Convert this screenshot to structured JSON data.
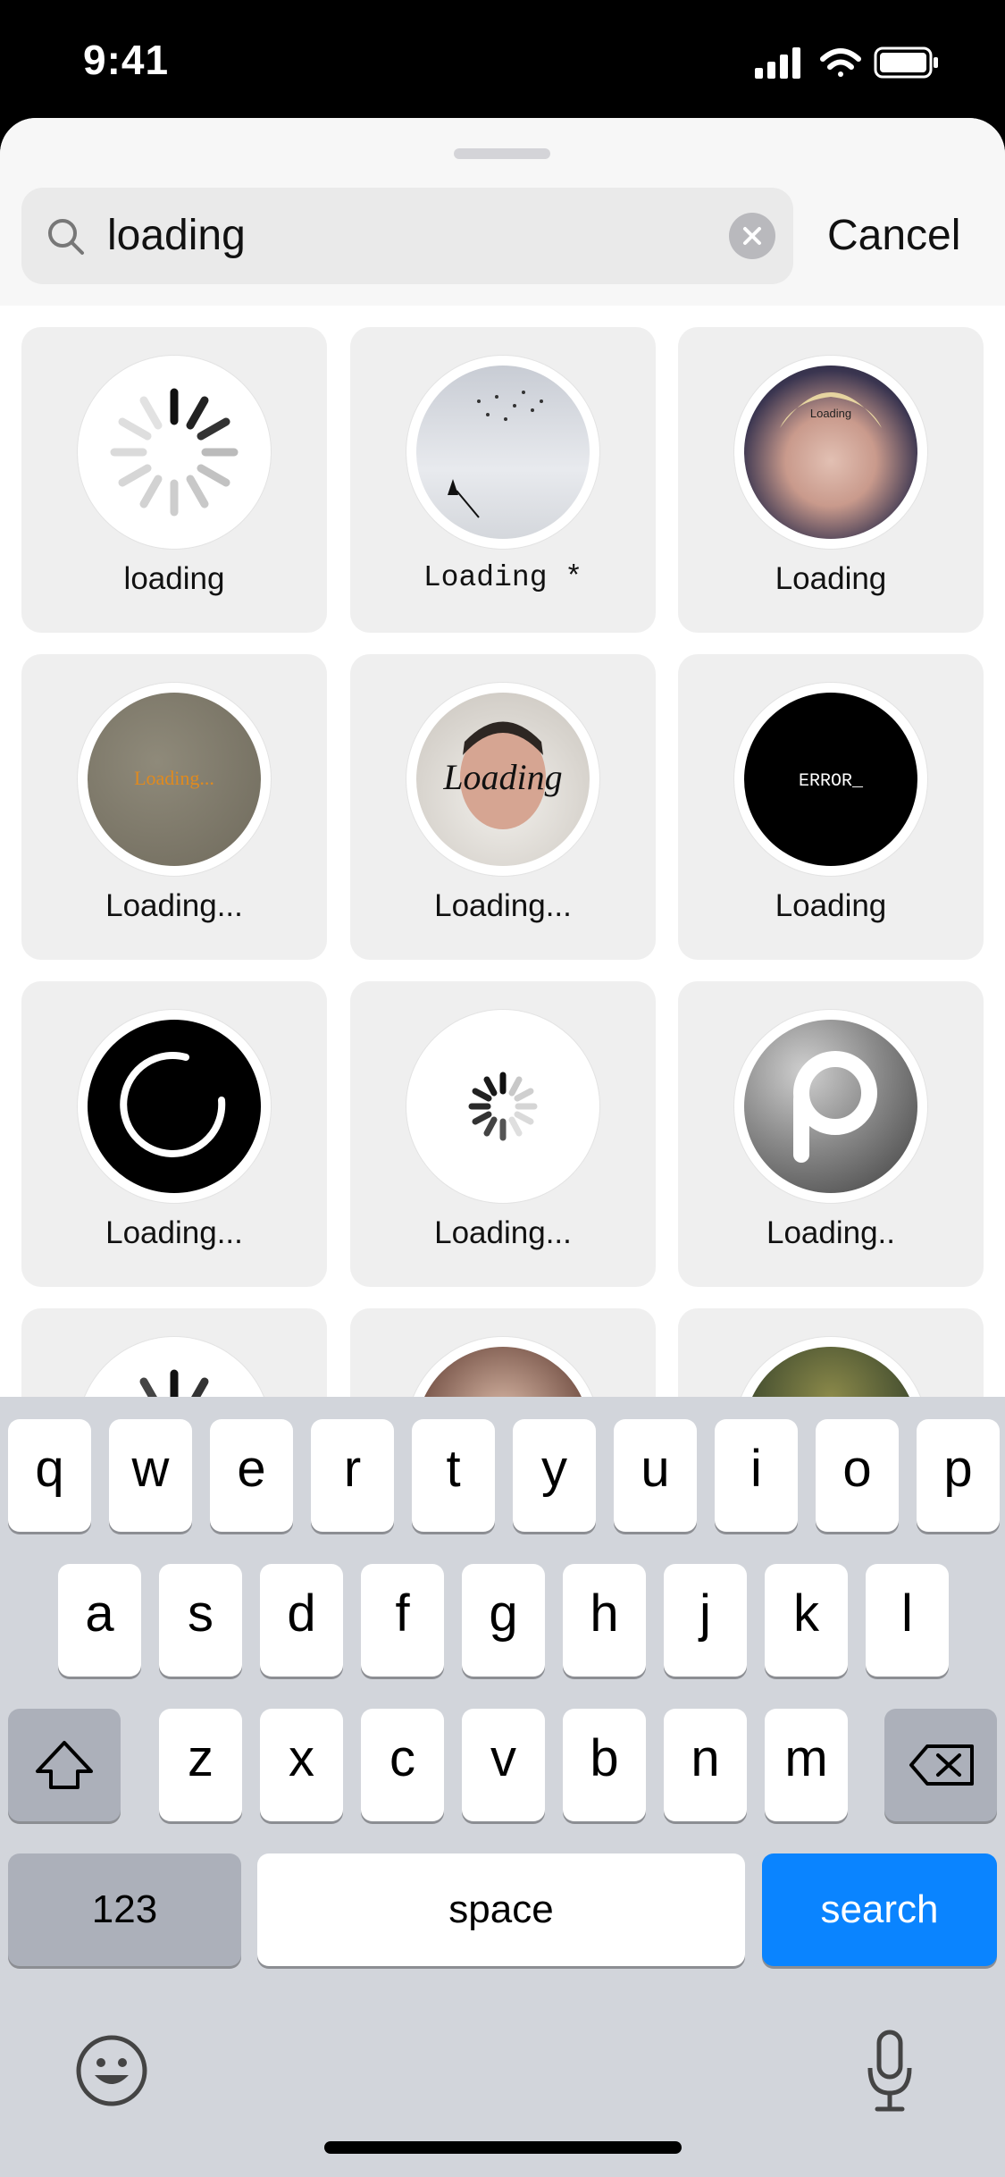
{
  "status_bar": {
    "time": "9:41"
  },
  "search": {
    "query": "loading",
    "cancel_label": "Cancel"
  },
  "results": [
    {
      "label": "loading"
    },
    {
      "label": "Loading *"
    },
    {
      "label": "Loading",
      "overlay_text": "Loading"
    },
    {
      "label": "Loading...",
      "overlay_text": "Loading..."
    },
    {
      "label": "Loading...",
      "overlay_text": "Loading"
    },
    {
      "label": "Loading",
      "overlay_text": "ERROR_"
    },
    {
      "label": "Loading..."
    },
    {
      "label": "Loading..."
    },
    {
      "label": "Loading.."
    }
  ],
  "keyboard": {
    "row1": [
      "q",
      "w",
      "e",
      "r",
      "t",
      "y",
      "u",
      "i",
      "o",
      "p"
    ],
    "row2": [
      "a",
      "s",
      "d",
      "f",
      "g",
      "h",
      "j",
      "k",
      "l"
    ],
    "row3": [
      "z",
      "x",
      "c",
      "v",
      "b",
      "n",
      "m"
    ],
    "numbers_label": "123",
    "space_label": "space",
    "search_label": "search"
  },
  "colors": {
    "accent": "#0a84ff",
    "keyboard_bg": "#d2d5db",
    "tile_bg": "#efefef"
  }
}
